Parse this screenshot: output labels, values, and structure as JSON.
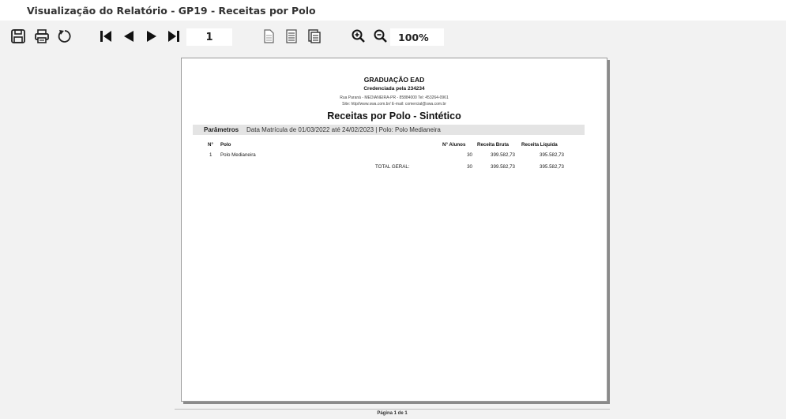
{
  "window": {
    "title": "Visualização do Relatório - GP19 - Receitas por Polo"
  },
  "toolbar": {
    "save_icon": "save-icon",
    "print_icon": "print-icon",
    "refresh_icon": "refresh-icon",
    "first_icon": "first-page-icon",
    "prev_icon": "previous-page-icon",
    "next_icon": "next-page-icon",
    "last_icon": "last-page-icon",
    "current_page": "1",
    "single_page_icon": "single-page-icon",
    "page_width_icon": "page-width-icon",
    "multi_page_icon": "multiple-pages-icon",
    "zoom_in_icon": "zoom-in-icon",
    "zoom_out_icon": "zoom-out-icon",
    "zoom": "100%"
  },
  "report": {
    "org_name": "GRADUAÇÃO EAD",
    "credential": "Credenciada pela 234234",
    "address": "Rua Paraná - MEDIANEIRA-PR - 85884000 Tel: 453264-0961",
    "site": "Site: http//www.swa.com.br/  E-mail: comercial@swa.com.br",
    "title": "Receitas por Polo - Sintético",
    "params_label": "Parâmetros",
    "params_value": "Data Matrícula de 01/03/2022 até 24/02/2023 | Polo: Polo Medianeira",
    "table": {
      "headers": {
        "num": "N°",
        "polo": "Polo",
        "alunos": "N° Alunos",
        "bruta": "Receita Bruta",
        "liquida": "Receita Líquida"
      },
      "rows": [
        {
          "num": "1",
          "polo": "Polo Medianeira",
          "alunos": "30",
          "bruta": "399.582,73",
          "liquida": "395.582,73"
        }
      ],
      "total": {
        "label": "TOTAL GERAL:",
        "alunos": "30",
        "bruta": "399.582,73",
        "liquida": "395.582,73"
      }
    },
    "footer": "Página 1 de 1"
  }
}
